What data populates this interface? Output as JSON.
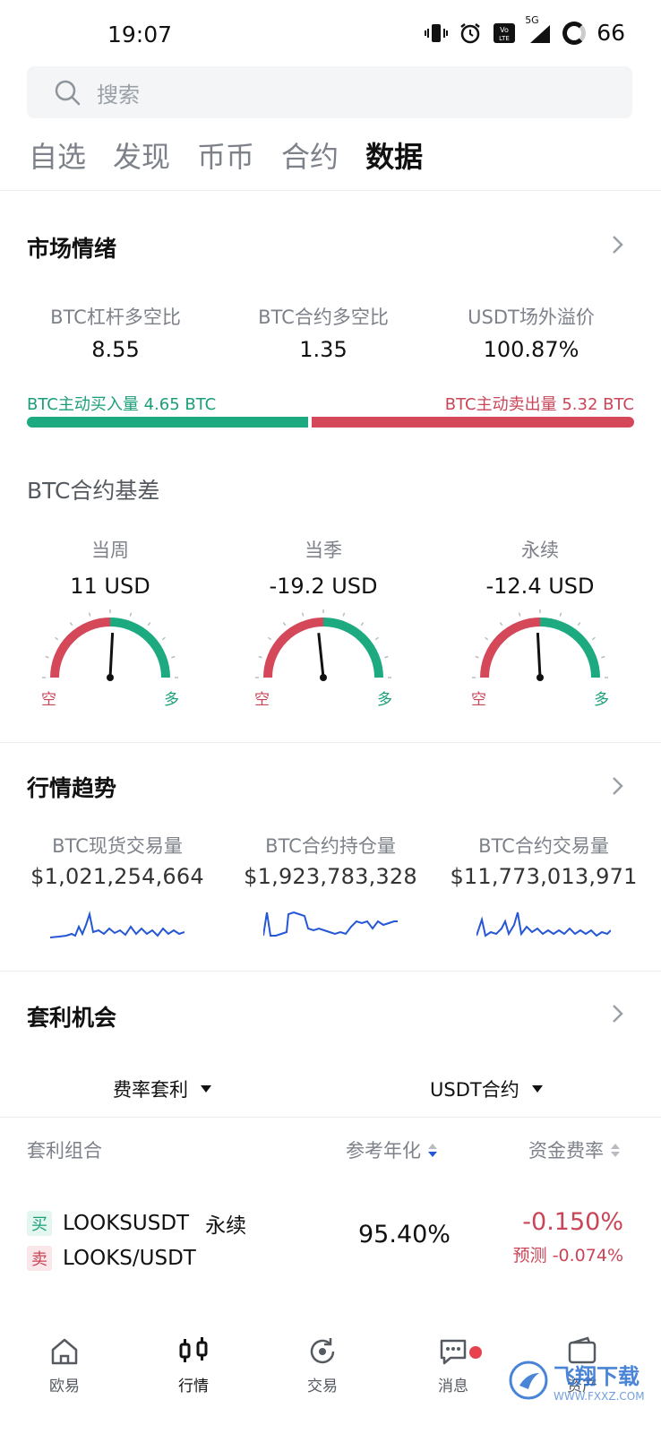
{
  "status_bar": {
    "time": "19:07",
    "network": "5G",
    "battery": "66"
  },
  "search": {
    "placeholder": "搜索"
  },
  "top_tabs": [
    "自选",
    "发现",
    "币币",
    "合约",
    "数据"
  ],
  "market_sentiment": {
    "title": "市场情绪",
    "metrics": [
      {
        "label": "BTC杠杆多空比",
        "value": "8.55"
      },
      {
        "label": "BTC合约多空比",
        "value": "1.35"
      },
      {
        "label": "USDT场外溢价",
        "value": "100.87%"
      }
    ],
    "buy_text": "BTC主动买入量 4.65 BTC",
    "sell_text": "BTC主动卖出量 5.32 BTC",
    "buy_volume": 4.65,
    "sell_volume": 5.32
  },
  "basis": {
    "title": "BTC合约基差",
    "short_label": "空",
    "long_label": "多",
    "gauges": [
      {
        "label": "当周",
        "value": "11 USD",
        "needle_deg": 3
      },
      {
        "label": "当季",
        "value": "-19.2 USD",
        "needle_deg": -6
      },
      {
        "label": "永续",
        "value": "-12.4 USD",
        "needle_deg": -3
      }
    ]
  },
  "trends": {
    "title": "行情趋势",
    "items": [
      {
        "label": "BTC现货交易量",
        "value": "$1,021,254,664"
      },
      {
        "label": "BTC合约持仓量",
        "value": "$1,923,783,328"
      },
      {
        "label": "BTC合约交易量",
        "value": "$11,773,013,971"
      }
    ]
  },
  "arbitrage": {
    "title": "套利机会",
    "filter_left": "费率套利",
    "filter_right": "USDT合约",
    "col_pair": "套利组合",
    "col_annual": "参考年化",
    "col_rate": "资金费率",
    "row": {
      "buy_tag": "买",
      "sell_tag": "卖",
      "buy_pair": "LOOKSUSDT",
      "buy_type": "永续",
      "sell_pair": "LOOKS/USDT",
      "annual": "95.40%",
      "rate": "-0.150%",
      "predicted": "预测 -0.074%"
    }
  },
  "bottom_nav": [
    {
      "label": "欧易",
      "icon": "home-icon"
    },
    {
      "label": "行情",
      "icon": "market-icon"
    },
    {
      "label": "交易",
      "icon": "trade-icon"
    },
    {
      "label": "消息",
      "icon": "message-icon"
    },
    {
      "label": "资产",
      "icon": "wallet-icon"
    }
  ],
  "watermark": {
    "text": "飞翔下载",
    "sub": "WWW.FXXZ.COM"
  },
  "colors": {
    "green": "#1daa80",
    "red": "#d44859",
    "accent_blue": "#2456d6"
  }
}
